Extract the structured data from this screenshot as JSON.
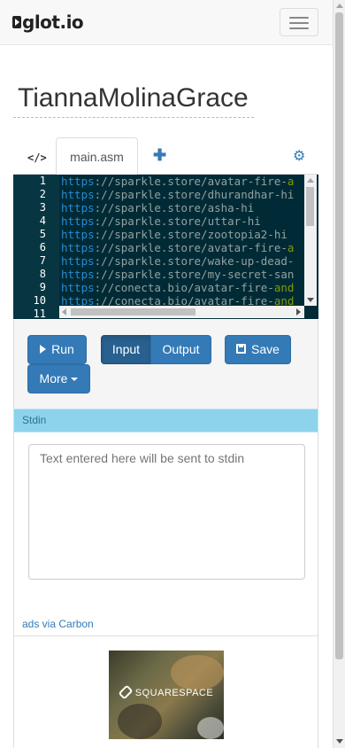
{
  "navbar": {
    "logo_text": "glot.io",
    "menu_icon": "hamburger-icon"
  },
  "page": {
    "title": "TiannaMolinaGrace"
  },
  "tabs": {
    "code_icon": "</>",
    "file_tab": "main.asm",
    "add_icon": "plus-icon",
    "settings_icon": "gear-icon"
  },
  "editor": {
    "lines": [
      {
        "num": "1",
        "proto": "https",
        "rest": "://sparkle.store/avatar-fire-",
        "kw": "a"
      },
      {
        "num": "2",
        "proto": "https",
        "rest": "://sparkle.store/dhurandhar-hi",
        "kw": ""
      },
      {
        "num": "3",
        "proto": "https",
        "rest": "://sparkle.store/asha-hi",
        "kw": ""
      },
      {
        "num": "4",
        "proto": "https",
        "rest": "://sparkle.store/uttar-hi",
        "kw": ""
      },
      {
        "num": "5",
        "proto": "https",
        "rest": "://sparkle.store/zootopia2-hi",
        "kw": ""
      },
      {
        "num": "6",
        "proto": "https",
        "rest": "://sparkle.store/avatar-fire-",
        "kw": "a"
      },
      {
        "num": "7",
        "proto": "https",
        "rest": "://sparkle.store/wake-up-dead-",
        "kw": ""
      },
      {
        "num": "8",
        "proto": "https",
        "rest": "://sparkle.store/my-secret-san",
        "kw": ""
      },
      {
        "num": "9",
        "proto": "https",
        "rest": "://conecta.bio/avatar-fire-",
        "kw": "and"
      },
      {
        "num": "10",
        "proto": "https",
        "rest": "://conecta.bio/avatar-fire-",
        "kw": "and"
      },
      {
        "num": "11",
        "proto": "",
        "rest": "",
        "kw": ""
      }
    ]
  },
  "actions": {
    "run_label": "Run",
    "input_label": "Input",
    "output_label": "Output",
    "save_label": "Save",
    "more_label": "More"
  },
  "stdin": {
    "heading": "Stdin",
    "placeholder": "Text entered here will be sent to stdin"
  },
  "ads": {
    "link_text": "ads via Carbon",
    "ad_brand": "SQUARESPACE"
  },
  "colors": {
    "editor_bg": "#002b36",
    "gutter_bg": "#073642",
    "primary": "#337ab7",
    "stdin_head": "#8dd3ec"
  }
}
